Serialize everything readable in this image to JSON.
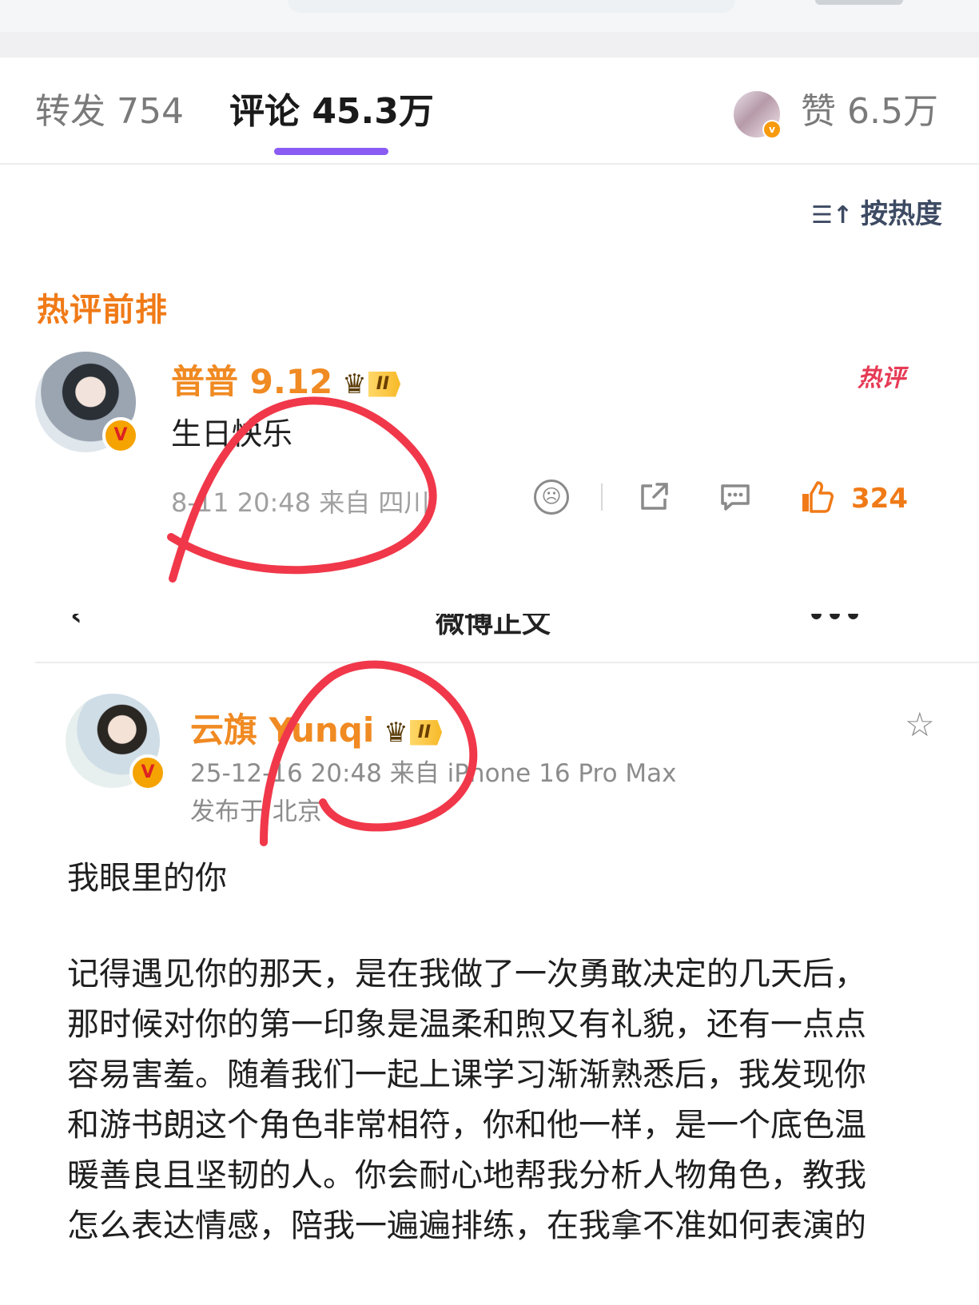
{
  "tabs": {
    "repost": "转发 754",
    "comment": "评论 45.3万",
    "like": "赞 6.5万"
  },
  "sort": {
    "icon": "sort-icon",
    "label": "按热度"
  },
  "section_title": "热评前排",
  "hot_comment": {
    "username": "普普 9.12",
    "level": "II",
    "hot_badge": "热评",
    "text": "生日快乐",
    "meta": "8-11 20:48  来自 四川",
    "like_count": "324"
  },
  "partial_header": {
    "left": "‹",
    "center": "微博正文",
    "right": "•••"
  },
  "post": {
    "username": "云旗 Yunqi",
    "level": "II",
    "meta_time": "25-12-16 20:48  来自 iPhone 16 Pro Max",
    "meta_location": "发布于 北京",
    "title": "我眼里的你",
    "body_lines": [
      "记得遇见你的那天，是在我做了一次勇敢决定的几天后，",
      "那时候对你的第一印象是温柔和煦又有礼貌，还有一点点",
      "容易害羞。随着我们一起上课学习渐渐熟悉后，我发现你",
      "和游书朗这个角色非常相符，你和他一样，是一个底色温",
      "暖善良且坚韧的人。你会耐心地帮我分析人物角色，教我",
      "怎么表达情感，陪我一遍遍排练，在我拿不准如何表演的"
    ]
  },
  "colors": {
    "accent_orange": "#f07a17",
    "tab_underline": "#8a5cf3",
    "annotation_red": "#f0384a"
  }
}
